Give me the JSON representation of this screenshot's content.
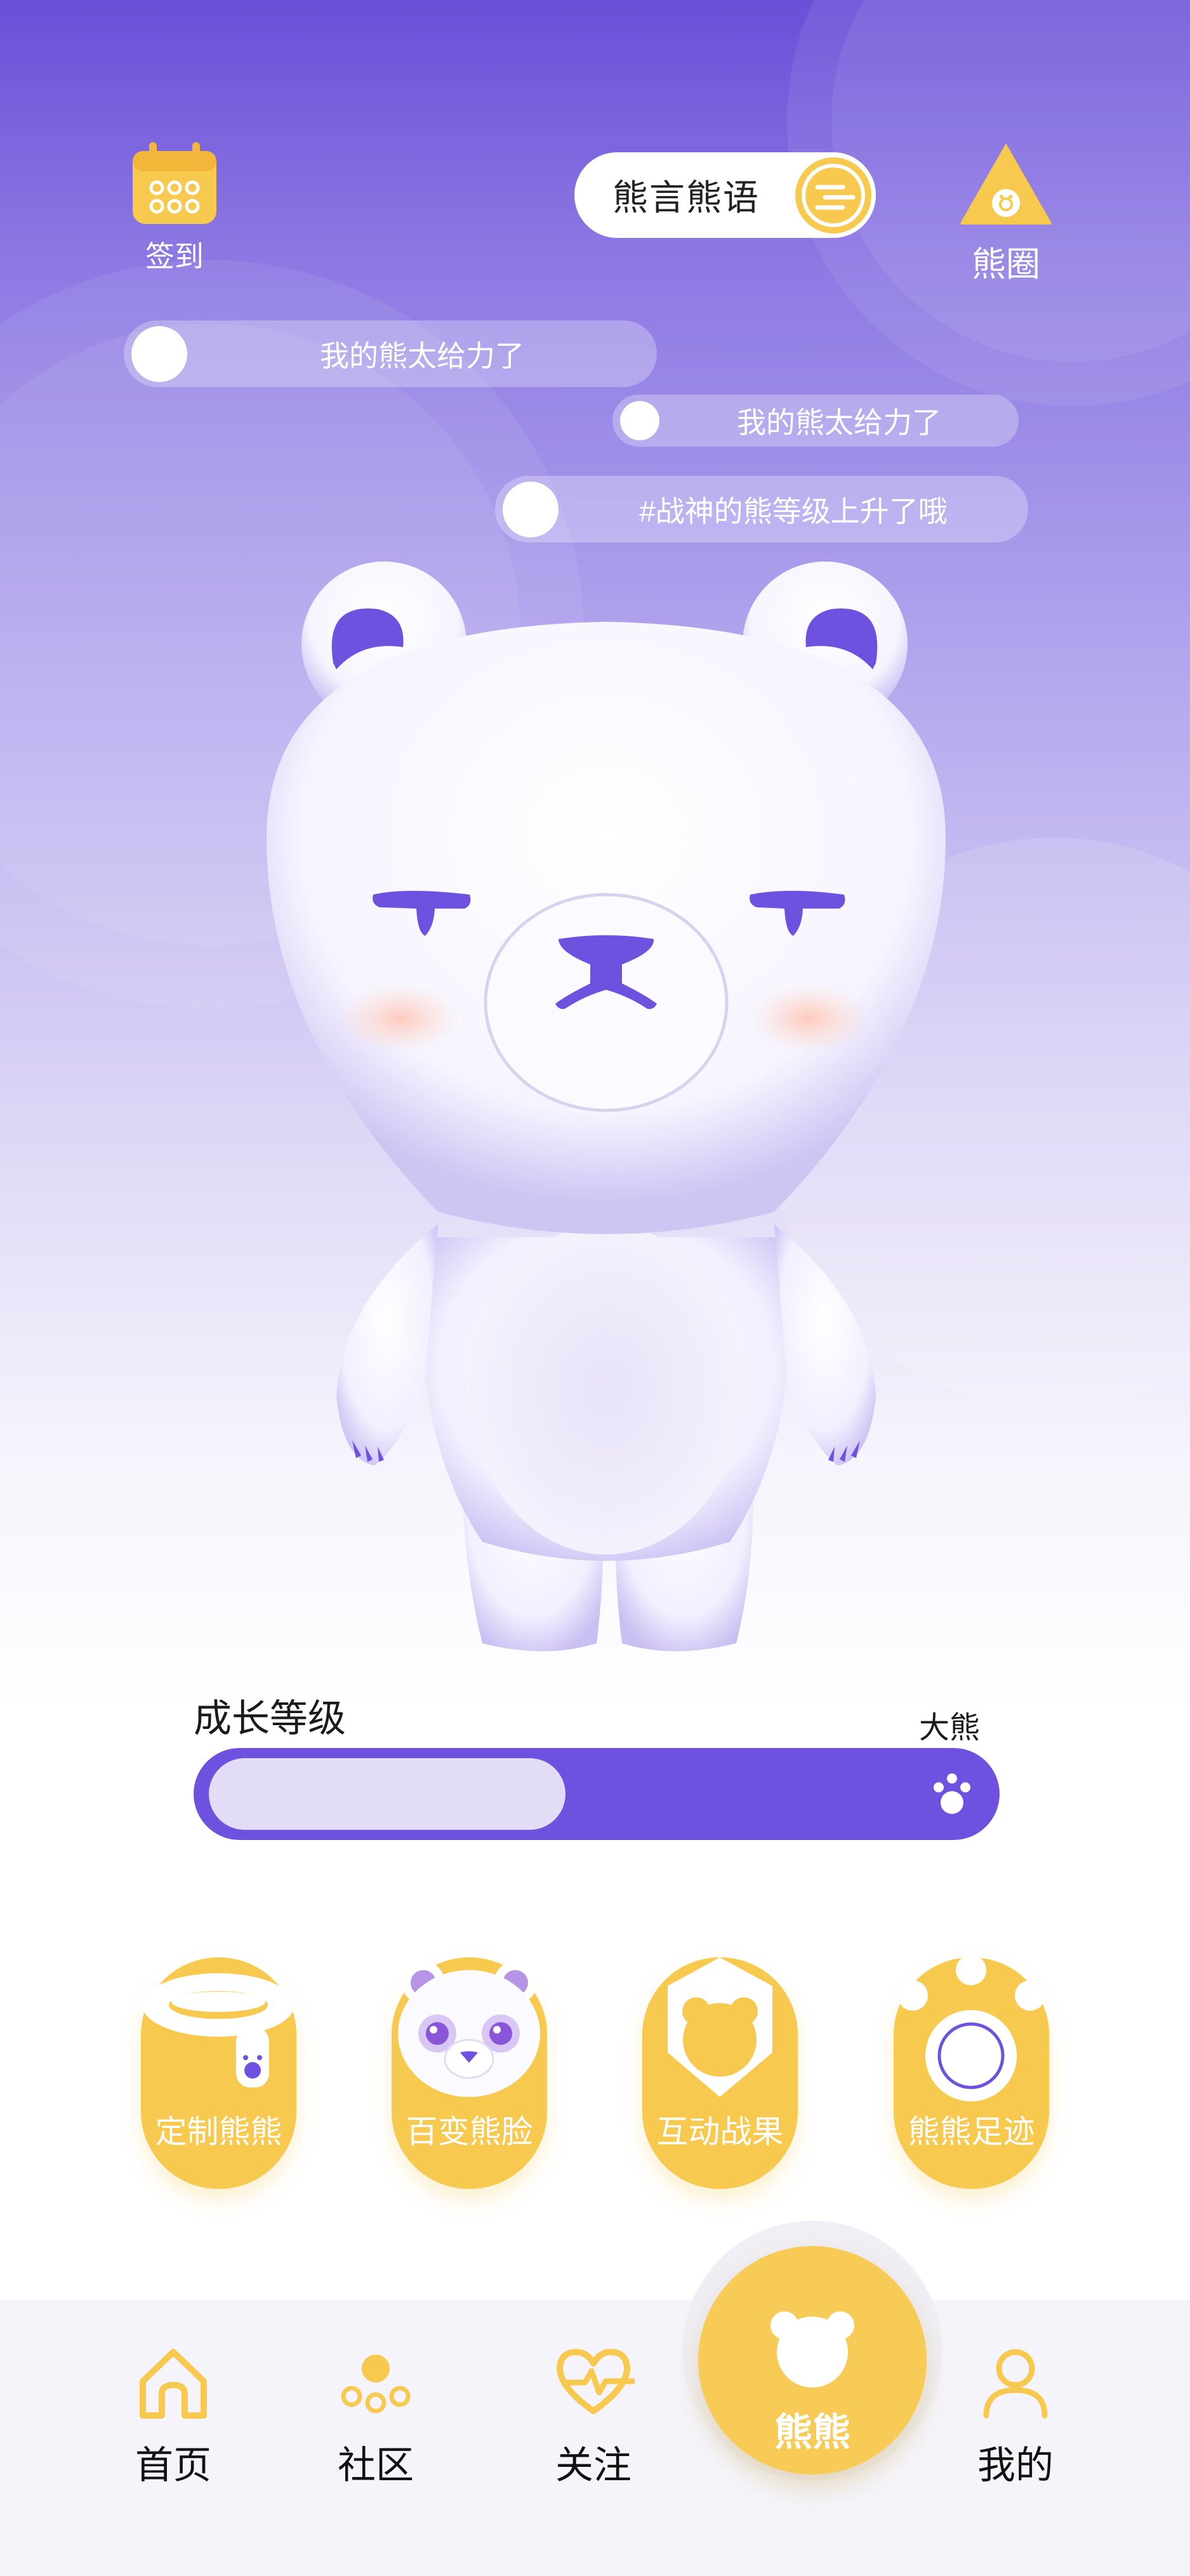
{
  "top": {
    "checkin_label": "签到",
    "quote_label": "熊言熊语",
    "circle_label": "熊圈"
  },
  "danmaku": [
    "我的熊太给力了",
    "我的熊太给力了",
    "#战神的熊等级上升了哦"
  ],
  "growth": {
    "title": "成长等级",
    "level_name": "大熊",
    "progress": 0.46
  },
  "features": [
    {
      "label": "定制熊熊",
      "icon": "halo-collar-icon"
    },
    {
      "label": "百变熊脸",
      "icon": "bear-face-icon"
    },
    {
      "label": "互动战果",
      "icon": "bear-badge-icon"
    },
    {
      "label": "熊熊足迹",
      "icon": "paw-footprint-icon"
    }
  ],
  "nav": {
    "home": "首页",
    "community": "社区",
    "follow": "关注",
    "bear": "熊熊",
    "mine": "我的"
  },
  "colors": {
    "primary_purple": "#6f51e0",
    "accent_yellow": "#f7c94e",
    "background_top": "#6a4fd8"
  }
}
